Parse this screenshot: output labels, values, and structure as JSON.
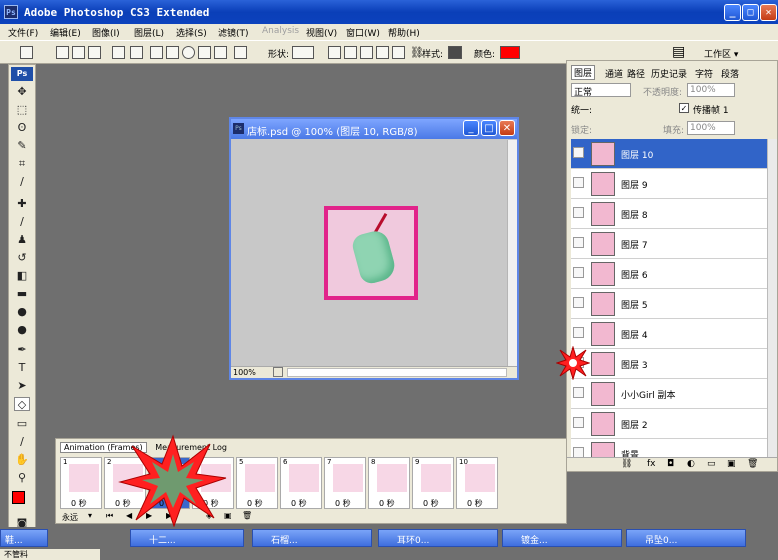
{
  "app": {
    "title": "Adobe Photoshop CS3 Extended",
    "ps_badge": "Ps"
  },
  "menu": [
    "文件(F)",
    "编辑(E)",
    "图像(I)",
    "图层(L)",
    "选择(S)",
    "滤镜(T)",
    "Analysis",
    "视图(V)",
    "窗口(W)",
    "帮助(H)"
  ],
  "options": {
    "shape_label": "形状:",
    "style_label": "样式:",
    "color_label": "颜色:",
    "workspace_label": "工作区 ▾",
    "style_color": "#4a4a4a",
    "color_swatch": "#ff0000"
  },
  "document": {
    "title": "店标.psd @ 100% (图层 10, RGB/8)",
    "zoom": "100%"
  },
  "layers_panel": {
    "tabs": [
      "图层",
      "通道",
      "路径",
      "历史记录",
      "字符",
      "段落"
    ],
    "blend_mode": "正常",
    "opacity_label": "不透明度:",
    "opacity_value": "100%",
    "unify_label": "统一:",
    "propagate_label": "传播帧 1",
    "lock_label": "锁定:",
    "fill_label": "填充:",
    "fill_value": "100%",
    "layers": [
      {
        "name": "图层 10",
        "selected": true
      },
      {
        "name": "图层 9",
        "selected": false
      },
      {
        "name": "图层 8",
        "selected": false
      },
      {
        "name": "图层 7",
        "selected": false
      },
      {
        "name": "图层 6",
        "selected": false
      },
      {
        "name": "图层 5",
        "selected": false
      },
      {
        "name": "图层 4",
        "selected": false
      },
      {
        "name": "图层 3",
        "selected": false
      },
      {
        "name": "小小Girl 副本",
        "selected": false
      },
      {
        "name": "图层 2",
        "selected": false
      },
      {
        "name": "背景",
        "selected": false
      }
    ]
  },
  "animation_panel": {
    "tabs": [
      "Animation (Frames)",
      "Measurement Log"
    ],
    "loop_label": "永远",
    "frames": [
      {
        "num": "1",
        "time": "0 秒"
      },
      {
        "num": "2",
        "time": "0 秒"
      },
      {
        "num": "3",
        "time": "0 秒"
      },
      {
        "num": "4",
        "time": "0 秒"
      },
      {
        "num": "5",
        "time": "0 秒"
      },
      {
        "num": "6",
        "time": "0 秒"
      },
      {
        "num": "7",
        "time": "0 秒"
      },
      {
        "num": "8",
        "time": "0 秒"
      },
      {
        "num": "9",
        "time": "0 秒"
      },
      {
        "num": "10",
        "time": "0 秒"
      }
    ]
  },
  "taskbar": {
    "items": [
      "十二...",
      "石榴...",
      "耳环0...",
      "镀金...",
      "吊坠0..."
    ],
    "start_label": "不管料",
    "first_label": "鞋..."
  }
}
